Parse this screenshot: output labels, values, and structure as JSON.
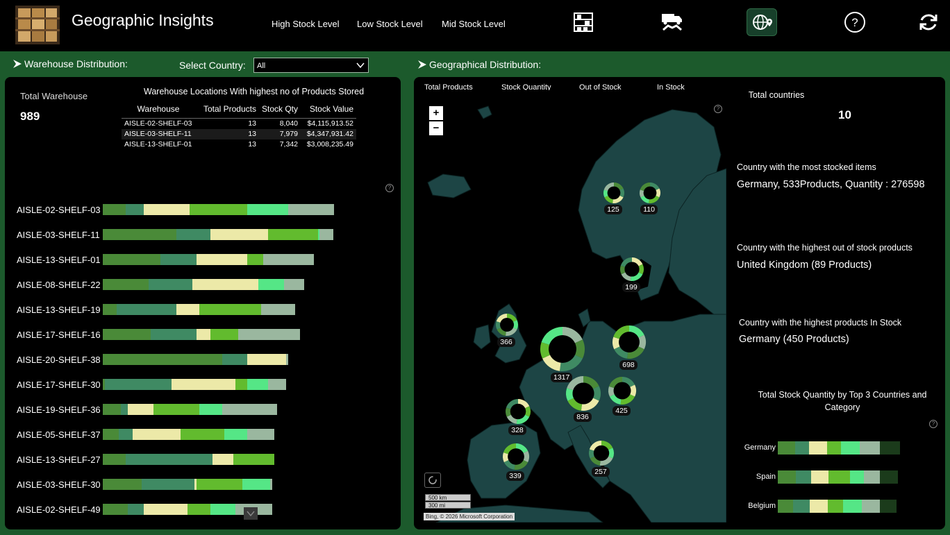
{
  "header": {
    "title": "Geographic Insights",
    "nav": [
      "High Stock Level",
      "Low Stock Level",
      "Mid Stock Level"
    ],
    "icons": [
      "warehouse-shelves-icon",
      "delivery-handshake-icon",
      "globe-pin-icon",
      "help-icon",
      "refresh-icon"
    ]
  },
  "filters": {
    "warehouse_section": "Warehouse Distribution:",
    "country_label": "Select Country:",
    "country_value": "All",
    "geo_section": "Geographical Distribution:"
  },
  "left": {
    "kpi_label": "Total Warehouse",
    "kpi_value": "989",
    "table_title": "Warehouse Locations With highest no of Products Stored",
    "table_headers": [
      "Warehouse",
      "Total Products",
      "Stock Qty",
      "Stock Value"
    ],
    "table_rows": [
      [
        "AISLE-02-SHELF-03",
        "13",
        "8,040",
        "$4,115,913.52"
      ],
      [
        "AISLE-03-SHELF-11",
        "13",
        "7,979",
        "$4,347,931.42"
      ],
      [
        "AISLE-13-SHELF-01",
        "13",
        "7,342",
        "$3,008,235.49"
      ]
    ],
    "bars": [
      {
        "label": "AISLE-02-SHELF-03",
        "segs": [
          0.1,
          0.08,
          0.2,
          0.25,
          0.18,
          0.2
        ]
      },
      {
        "label": "AISLE-03-SHELF-11",
        "segs": [
          0.32,
          0.15,
          0.25,
          0.22,
          0.006,
          0.06
        ]
      },
      {
        "label": "AISLE-13-SHELF-01",
        "segs": [
          0.25,
          0.16,
          0.22,
          0.07,
          0.0,
          0.22
        ]
      },
      {
        "label": "AISLE-08-SHELF-22",
        "segs": [
          0.2,
          0.19,
          0.29,
          0.0,
          0.11,
          0.09
        ]
      },
      {
        "label": "AISLE-13-SHELF-19",
        "segs": [
          0.06,
          0.26,
          0.1,
          0.27,
          0.0,
          0.15
        ]
      },
      {
        "label": "AISLE-17-SHELF-16",
        "segs": [
          0.21,
          0.2,
          0.06,
          0.12,
          0.0,
          0.27
        ]
      },
      {
        "label": "AISLE-20-SHELF-38",
        "segs": [
          0.52,
          0.11,
          0.17,
          0.0,
          0.0,
          0.01
        ]
      },
      {
        "label": "AISLE-17-SHELF-30",
        "segs": [
          0.01,
          0.29,
          0.28,
          0.05,
          0.09,
          0.08
        ]
      },
      {
        "label": "AISLE-19-SHELF-36",
        "segs": [
          0.08,
          0.03,
          0.11,
          0.2,
          0.1,
          0.24
        ]
      },
      {
        "label": "AISLE-05-SHELF-37",
        "segs": [
          0.07,
          0.06,
          0.21,
          0.19,
          0.1,
          0.12
        ]
      },
      {
        "label": "AISLE-13-SHELF-27",
        "segs": [
          0.1,
          0.38,
          0.09,
          0.18,
          0.0,
          0.0
        ]
      },
      {
        "label": "AISLE-03-SHELF-30",
        "segs": [
          0.17,
          0.23,
          0.01,
          0.2,
          0.12,
          0.01
        ]
      },
      {
        "label": "AISLE-02-SHELF-49",
        "segs": [
          0.11,
          0.07,
          0.19,
          0.1,
          0.11,
          0.16
        ]
      }
    ]
  },
  "map": {
    "tabs": [
      "Total Products",
      "Stock Quantity",
      "Out of Stock",
      "In Stock"
    ],
    "attribution": "Bing, © 2026 Microsoft Corporation",
    "scale_km": "500 km",
    "scale_mi": "300 mi",
    "bubbles": [
      {
        "value": "125"
      },
      {
        "value": "110"
      },
      {
        "value": "199"
      },
      {
        "value": "366"
      },
      {
        "value": "698"
      },
      {
        "value": "1317"
      },
      {
        "value": "836"
      },
      {
        "value": "425"
      },
      {
        "value": "328"
      },
      {
        "value": "257"
      },
      {
        "value": "339"
      }
    ]
  },
  "insights": {
    "total_countries_label": "Total countries",
    "total_countries_value": "10",
    "most_stocked_label": "Country with the most stocked items",
    "most_stocked_value": "Germany, 533Products, Quantity : 276598",
    "out_of_stock_label": "Country with the highest out of stock products",
    "out_of_stock_value": "United Kingdom (89 Products)",
    "in_stock_label": "Country with the highest products In Stock",
    "in_stock_value": "Germany (450 Products)",
    "category_title": "Total Stock Quantity by Top 3 Countries and Category",
    "category_rows": [
      {
        "country": "Germany",
        "segs": [
          0.14,
          0.11,
          0.14,
          0.11,
          0.15,
          0.16,
          0.16
        ]
      },
      {
        "country": "Spain",
        "segs": [
          0.15,
          0.13,
          0.14,
          0.18,
          0.12,
          0.13,
          0.15
        ]
      },
      {
        "country": "Belgium",
        "segs": [
          0.13,
          0.14,
          0.15,
          0.13,
          0.16,
          0.15,
          0.14
        ]
      }
    ]
  },
  "colors": {
    "seg": [
      "#4a8a38",
      "#3f8a63",
      "#ece9a8",
      "#62bb2e",
      "#55e686",
      "#9ab79f",
      "#1b3b1b"
    ],
    "land": "#1d4545",
    "background": "#1c5a2c"
  }
}
